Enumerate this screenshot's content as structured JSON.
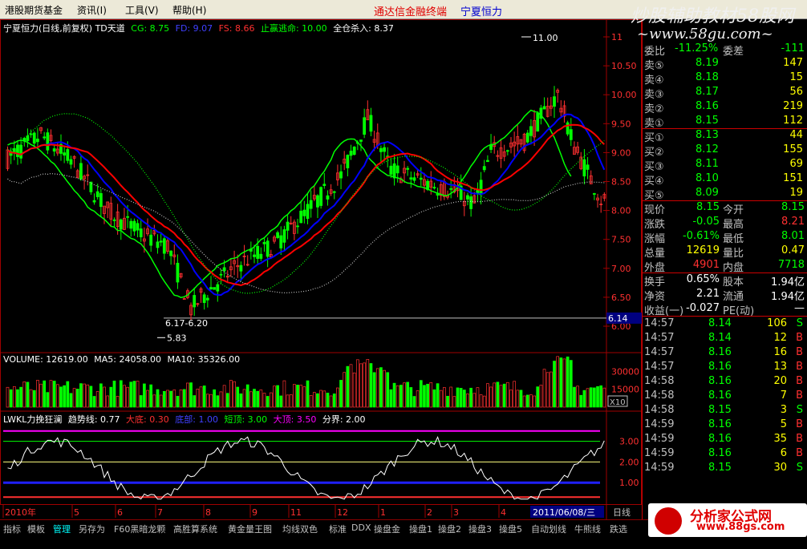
{
  "menu": {
    "items": [
      "港股期货基金",
      "资讯(I)",
      "工具(V)",
      "帮助(H)"
    ],
    "title1": "通达信金融终端",
    "title2": "宁夏恒力"
  },
  "watermark": {
    "line1": "炒股辅助教材58股网",
    "line2": "~www.58gu.com~",
    "bottom1": "分析家公式网",
    "bottom2": "www.88gs.com"
  },
  "main_legend": {
    "name": "宁夏恒力(日线,前复权) TD天道",
    "cg": "CG: 8.75",
    "fd": "FD: 9.07",
    "fs": "FS: 8.66",
    "zy": "止赢逃命: 10.00",
    "qc": "全仓杀入: 8.37"
  },
  "price_axis": [
    "11",
    "10.50",
    "10.00",
    "9.50",
    "9.00",
    "8.50",
    "8.00",
    "7.50",
    "7.00",
    "6.50",
    "6.00"
  ],
  "price_marker": "6.14",
  "annotations": {
    "high": "11.00",
    "low_range": "6.17-6.20",
    "low": "5.83"
  },
  "volume_legend": {
    "volume": "VOLUME: 12619.00",
    "ma5": "MA5: 24058.00",
    "ma10": "MA10: 35326.00",
    "axis_top": "30000",
    "axis_mid": "15000",
    "multiplier": "X10"
  },
  "lwkl_legend": {
    "name": "LWKL力挽狂澜",
    "trend": "趋势线: 0.77",
    "bottom": "大底: 0.30",
    "low": "底部: 1.00",
    "short": "短顶: 3.00",
    "top": "大顶: 3.50",
    "border": "分界: 2.00"
  },
  "lwkl_axis": [
    "3.00",
    "2.00",
    "1.00"
  ],
  "date_axis": {
    "labels": [
      "2010年",
      "5",
      "6",
      "7",
      "8",
      "9",
      "11",
      "12",
      "1",
      "2",
      "3",
      "4"
    ],
    "current": "2011/06/08/三",
    "period": "日线"
  },
  "quote": {
    "ratio_label": "委比",
    "ratio_value": "-11.25%",
    "diff_label": "委差",
    "diff_value": "-111",
    "asks": [
      {
        "label": "卖⑤",
        "price": "8.19",
        "vol": "147"
      },
      {
        "label": "卖④",
        "price": "8.18",
        "vol": "15"
      },
      {
        "label": "卖③",
        "price": "8.17",
        "vol": "56"
      },
      {
        "label": "卖②",
        "price": "8.16",
        "vol": "219"
      },
      {
        "label": "卖①",
        "price": "8.15",
        "vol": "112"
      }
    ],
    "bids": [
      {
        "label": "买①",
        "price": "8.13",
        "vol": "44"
      },
      {
        "label": "买②",
        "price": "8.12",
        "vol": "155"
      },
      {
        "label": "买③",
        "price": "8.11",
        "vol": "69"
      },
      {
        "label": "买④",
        "price": "8.10",
        "vol": "151"
      },
      {
        "label": "买⑤",
        "price": "8.09",
        "vol": "19"
      }
    ],
    "stats": [
      {
        "l1": "现价",
        "v1": "8.15",
        "l2": "今开",
        "v2": "8.15"
      },
      {
        "l1": "涨跌",
        "v1": "-0.05",
        "l2": "最高",
        "v2": "8.21"
      },
      {
        "l1": "涨幅",
        "v1": "-0.61%",
        "l2": "最低",
        "v2": "8.01"
      },
      {
        "l1": "总量",
        "v1": "12619",
        "l2": "量比",
        "v2": "0.47"
      },
      {
        "l1": "外盘",
        "v1": "4901",
        "l2": "内盘",
        "v2": "7718"
      }
    ],
    "fund": [
      {
        "l1": "换手",
        "v1": "0.65%",
        "l2": "股本",
        "v2": "1.94亿"
      },
      {
        "l1": "净资",
        "v1": "2.21",
        "l2": "流通",
        "v2": "1.94亿"
      },
      {
        "l1": "收益(一)",
        "v1": "-0.027",
        "l2": "PE(动)",
        "v2": "—"
      }
    ],
    "ticks": [
      {
        "time": "14:57",
        "price": "8.14",
        "vol": "106",
        "side": "S"
      },
      {
        "time": "14:57",
        "price": "8.14",
        "vol": "12",
        "side": "B"
      },
      {
        "time": "14:57",
        "price": "8.16",
        "vol": "16",
        "side": "B"
      },
      {
        "time": "14:57",
        "price": "8.16",
        "vol": "13",
        "side": "B"
      },
      {
        "time": "14:58",
        "price": "8.16",
        "vol": "20",
        "side": "B"
      },
      {
        "time": "14:58",
        "price": "8.16",
        "vol": "7",
        "side": "B"
      },
      {
        "time": "14:58",
        "price": "8.15",
        "vol": "3",
        "side": "S"
      },
      {
        "time": "14:59",
        "price": "8.16",
        "vol": "5",
        "side": "B"
      },
      {
        "time": "14:59",
        "price": "8.16",
        "vol": "35",
        "side": "B"
      },
      {
        "time": "14:59",
        "price": "8.16",
        "vol": "6",
        "side": "B"
      },
      {
        "time": "14:59",
        "price": "8.15",
        "vol": "30",
        "side": "S"
      }
    ]
  },
  "tabs": [
    "指标",
    "模板",
    "管理",
    "另存为",
    "F60黑暗龙颗",
    "高胜算系统",
    "黄金量王图",
    "均线双色",
    "标准",
    "DDX",
    "操盘金",
    "操盘1",
    "操盘2",
    "操盘3",
    "操盘5",
    "自动划线",
    "牛熊线",
    "跌选"
  ],
  "colors": {
    "up": "#ff3030",
    "down": "#00ff00",
    "bg": "#000000",
    "grid": "#800000",
    "fd": "#0000ff",
    "fs": "#ff0000",
    "cg": "#00ff00",
    "zy": "#00ff00",
    "qc": "#00ff00",
    "purple": "#ff00ff",
    "yellow": "#ffff80",
    "blue": "#2020ff"
  }
}
